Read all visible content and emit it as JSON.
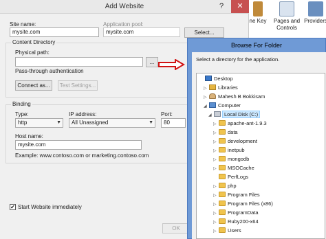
{
  "background_app": {
    "items": [
      {
        "label": "ne Key"
      },
      {
        "label": "Pages and\nControls"
      },
      {
        "label": "Providers"
      }
    ]
  },
  "add_website": {
    "title": "Add Website",
    "help": "?",
    "close": "✕",
    "site_name_label": "Site name:",
    "site_name_value": "mysite.com",
    "app_pool_label": "Application pool:",
    "app_pool_value": "mysite.com",
    "select_button": "Select...",
    "content_dir_label": "Content Directory",
    "physical_path_label": "Physical path:",
    "physical_path_value": "",
    "browse_button": "...",
    "passthrough_label": "Pass-through authentication",
    "connect_as_button": "Connect as...",
    "test_settings_button": "Test Settings...",
    "binding_label": "Binding",
    "type_label": "Type:",
    "type_value": "http",
    "ip_label": "IP address:",
    "ip_value": "All Unassigned",
    "port_label": "Port:",
    "port_value": "80",
    "host_label": "Host name:",
    "host_value": "mysite.com",
    "example_text": "Example: www.contoso.com or marketing.contoso.com",
    "start_label": "Start Website immediately",
    "start_checked": true,
    "ok_button": "OK"
  },
  "browse_folder": {
    "title": "Browse For Folder",
    "instruction": "Select a directory for the application.",
    "tree": [
      {
        "label": "Desktop",
        "icon": "desktop-icon",
        "depth": 0,
        "expander": ""
      },
      {
        "label": "Libraries",
        "icon": "libraries-icon",
        "depth": 1,
        "expander": "▷"
      },
      {
        "label": "Mahesh B Bokkisam",
        "icon": "user-icon",
        "depth": 1,
        "expander": "▷"
      },
      {
        "label": "Computer",
        "icon": "computer-icon",
        "depth": 1,
        "expander": "◢"
      },
      {
        "label": "Local Disk (C:)",
        "icon": "drive-icon",
        "depth": 2,
        "expander": "◢",
        "selected": true
      },
      {
        "label": "apache-ant-1.9.3",
        "icon": "folder-icon",
        "depth": 3,
        "expander": "▷"
      },
      {
        "label": "data",
        "icon": "folder-icon",
        "depth": 3,
        "expander": "▷"
      },
      {
        "label": "development",
        "icon": "folder-icon",
        "depth": 3,
        "expander": "▷"
      },
      {
        "label": "inetpub",
        "icon": "folder-icon",
        "depth": 3,
        "expander": "▷"
      },
      {
        "label": "mongodb",
        "icon": "folder-icon",
        "depth": 3,
        "expander": "▷"
      },
      {
        "label": "MSOCache",
        "icon": "folder-icon",
        "depth": 3,
        "expander": "▷"
      },
      {
        "label": "PerfLogs",
        "icon": "folder-icon",
        "depth": 3,
        "expander": ""
      },
      {
        "label": "php",
        "icon": "folder-icon",
        "depth": 3,
        "expander": "▷"
      },
      {
        "label": "Program Files",
        "icon": "folder-icon",
        "depth": 3,
        "expander": "▷"
      },
      {
        "label": "Program Files (x86)",
        "icon": "folder-icon",
        "depth": 3,
        "expander": "▷"
      },
      {
        "label": "ProgramData",
        "icon": "folder-icon",
        "depth": 3,
        "expander": "▷"
      },
      {
        "label": "Ruby200-x64",
        "icon": "folder-icon",
        "depth": 3,
        "expander": "▷"
      },
      {
        "label": "Users",
        "icon": "folder-icon",
        "depth": 3,
        "expander": "▷"
      }
    ]
  },
  "colors": {
    "browse_frame": "#6f9ad6",
    "close_button": "#c75050",
    "arrow": "#d11414"
  }
}
